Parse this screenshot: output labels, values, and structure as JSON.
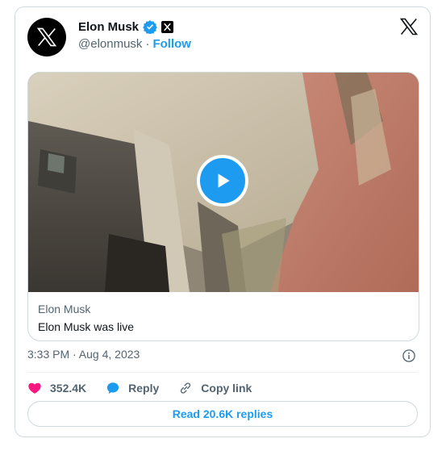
{
  "author": {
    "display_name": "Elon Musk",
    "handle": "@elonmusk",
    "separator": "·",
    "follow_label": "Follow"
  },
  "media": {
    "card_author": "Elon Musk",
    "card_title": "Elon Musk was live"
  },
  "meta": {
    "timestamp": "3:33 PM · Aug 4, 2023"
  },
  "actions": {
    "likes": "352.4K",
    "reply_label": "Reply",
    "copy_link_label": "Copy link"
  },
  "read_replies_label": "Read 20.6K replies",
  "colors": {
    "accent": "#1d9bf0",
    "like": "#f91880",
    "text_secondary": "#536471"
  },
  "icons": [
    "x-avatar-icon",
    "verified-badge-icon",
    "affiliate-x-icon",
    "x-logo-icon",
    "play-icon",
    "info-icon",
    "heart-icon",
    "reply-icon",
    "link-icon"
  ]
}
